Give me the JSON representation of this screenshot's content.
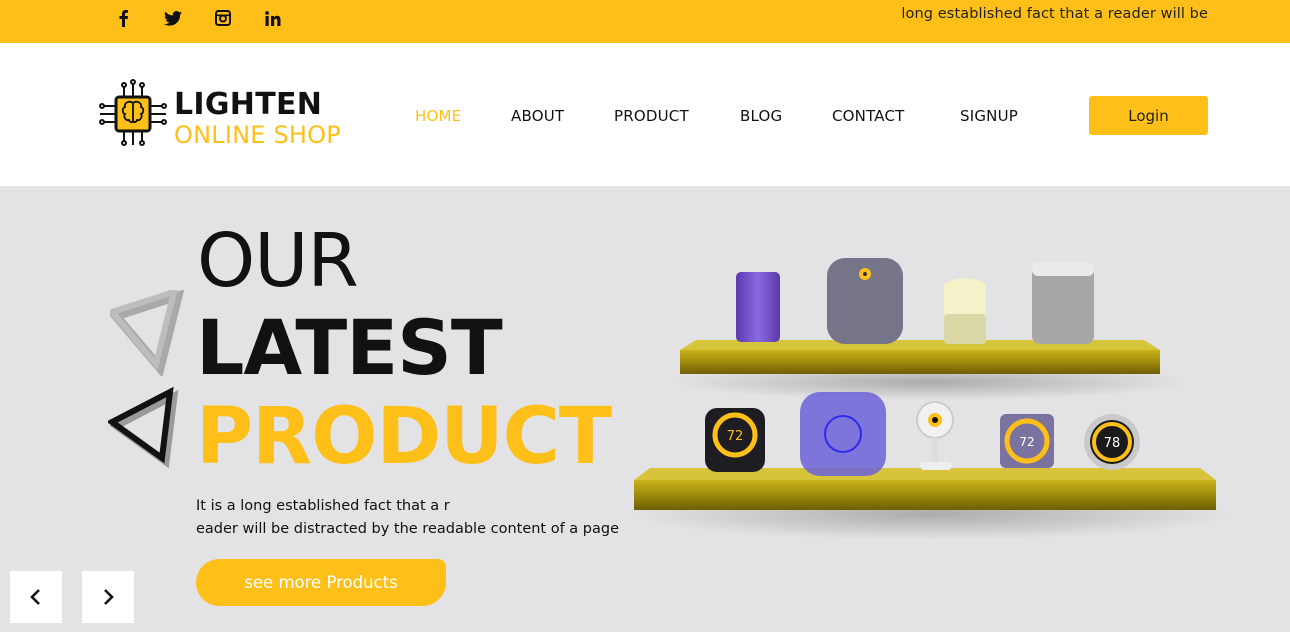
{
  "topbar": {
    "social": [
      {
        "name": "facebook",
        "glyph": "f"
      },
      {
        "name": "twitter",
        "glyph": "t"
      },
      {
        "name": "instagram",
        "glyph": "ig"
      },
      {
        "name": "linkedin",
        "glyph": "in"
      }
    ],
    "tagline": "long established fact that a reader will be"
  },
  "header": {
    "logo_name": "LIGHTEN",
    "logo_sub": "ONLINE SHOP",
    "nav": {
      "home": "HOME",
      "about": "ABOUT",
      "product": "PRODUCT",
      "blog": "BLOG",
      "contact": "CONTACT",
      "signup": "SIGNUP"
    },
    "active_nav": "HOME",
    "login_label": "Login"
  },
  "hero": {
    "line1": "OUR",
    "line2": "LATEST",
    "line3": "PRODUCT",
    "desc_line1": "It is a long established fact that a r",
    "desc_line2": "eader will be distracted by the readable content of a page",
    "cta_label": "see more Products",
    "devices": {
      "thermostat_left": "72",
      "thermostat_square": "72",
      "thermostat_right": "78"
    }
  },
  "colors": {
    "accent": "#fec018",
    "hero_bg": "#e3e2e4",
    "text": "#111111"
  },
  "icons": {
    "prev": "chevron-left-icon",
    "next": "chevron-right-icon"
  }
}
